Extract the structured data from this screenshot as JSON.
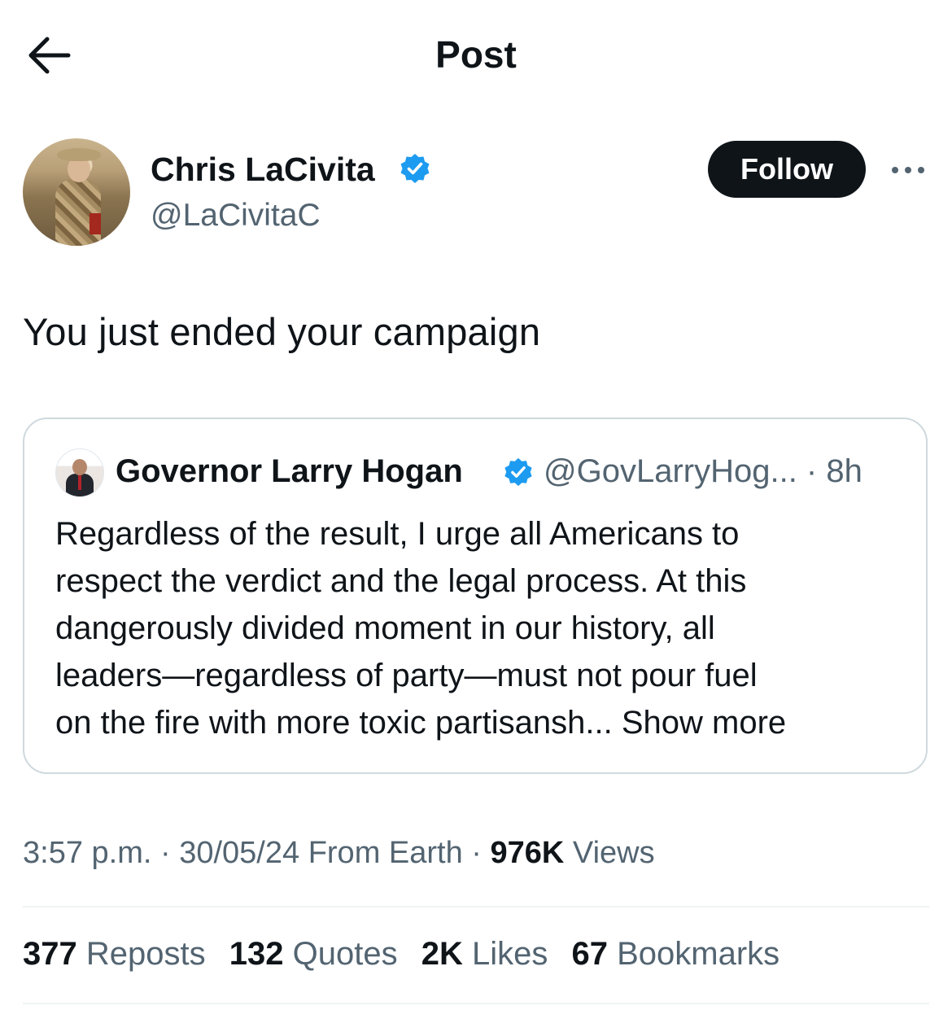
{
  "header": {
    "title": "Post",
    "back_icon": "arrow-left-icon"
  },
  "author": {
    "name": "Chris LaCivita",
    "handle": "@LaCivitaC",
    "verified": true,
    "follow_label": "Follow",
    "more_icon": "more-horizontal-icon"
  },
  "tweet": {
    "text": "You just ended your campaign"
  },
  "quote": {
    "name": "Governor Larry Hogan",
    "handle_time": "@GovLarryHog... · 8h",
    "lines": [
      "Regardless of the result, I urge all Americans to",
      "respect the verdict and the legal process. At this",
      "dangerously divided moment in our history, all",
      "leaders—regardless of party—must not pour fuel"
    ],
    "last_line": "on the fire with more toxic partisansh...",
    "show_more": "Show more"
  },
  "meta": {
    "time": "3:57 p.m.",
    "date": "30/05/24",
    "source": "From Earth",
    "views_count": "976K",
    "views_label": "Views"
  },
  "stats": {
    "reposts_count": "377",
    "reposts_label": "Reposts",
    "quotes_count": "132",
    "quotes_label": "Quotes",
    "likes_count": "2K",
    "likes_label": "Likes",
    "bookmarks_count": "67",
    "bookmarks_label": "Bookmarks"
  },
  "colors": {
    "text_primary": "#0f1419",
    "text_secondary": "#536471",
    "verified_blue": "#1d9bf0",
    "border": "#cfd9de",
    "follow_bg": "#0f1419"
  }
}
